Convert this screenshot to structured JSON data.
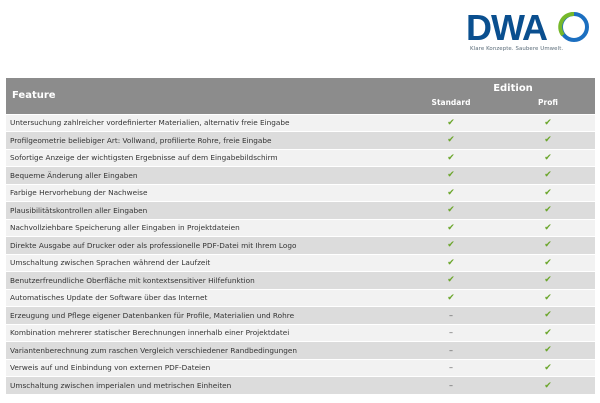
{
  "logo": {
    "wordmark": "DWA",
    "tagline": "Klare Konzepte. Saubere Umwelt.",
    "colors": {
      "text": "#0a4f8f",
      "ring_blue": "#1c6fc0",
      "ring_green": "#76b82a"
    }
  },
  "table": {
    "header": {
      "feature": "Feature",
      "edition": "Edition",
      "standard": "Standard",
      "profi": "Profi"
    },
    "rows": [
      {
        "feature": "Untersuchung zahlreicher vordefinierter Materialien, alternativ freie Eingabe",
        "standard": "✔",
        "profi": "✔"
      },
      {
        "feature": "Profilgeometrie beliebiger Art: Vollwand, profilierte Rohre, freie Eingabe",
        "standard": "✔",
        "profi": "✔"
      },
      {
        "feature": "Sofortige Anzeige der wichtigsten Ergebnisse auf dem Eingabebildschirm",
        "standard": "✔",
        "profi": "✔"
      },
      {
        "feature": "Bequeme Änderung aller Eingaben",
        "standard": "✔",
        "profi": "✔"
      },
      {
        "feature": "Farbige Hervorhebung der Nachweise",
        "standard": "✔",
        "profi": "✔"
      },
      {
        "feature": "Plausibilitätskontrollen aller Eingaben",
        "standard": "✔",
        "profi": "✔"
      },
      {
        "feature": "Nachvollziehbare Speicherung aller Eingaben in Projektdateien",
        "standard": "✔",
        "profi": "✔"
      },
      {
        "feature": "Direkte Ausgabe auf Drucker oder als professionelle PDF-Datei mit Ihrem Logo",
        "standard": "✔",
        "profi": "✔"
      },
      {
        "feature": "Umschaltung zwischen Sprachen während der Laufzeit",
        "standard": "✔",
        "profi": "✔"
      },
      {
        "feature": "Benutzerfreundliche Oberfläche mit kontextsensitiver Hilfefunktion",
        "standard": "✔",
        "profi": "✔"
      },
      {
        "feature": "Automatisches Update der Software über das Internet",
        "standard": "✔",
        "profi": "✔"
      },
      {
        "feature": "Erzeugung und Pflege eigener Datenbanken für Profile, Materialien und Rohre",
        "standard": "–",
        "profi": "✔"
      },
      {
        "feature": "Kombination mehrerer statischer Berechnungen innerhalb einer Projektdatei",
        "standard": "–",
        "profi": "✔"
      },
      {
        "feature": "Variantenberechnung zum raschen Vergleich verschiedener Randbedingungen",
        "standard": "–",
        "profi": "✔"
      },
      {
        "feature": "Verweis auf und Einbindung von externen PDF-Dateien",
        "standard": "–",
        "profi": "✔"
      },
      {
        "feature": "Umschaltung zwischen imperialen und metrischen Einheiten",
        "standard": "–",
        "profi": "✔"
      }
    ],
    "colors": {
      "header_bg": "#8c8c8c",
      "row_light": "#f2f2f2",
      "row_dark": "#dcdcdc",
      "check": "#6aa52a"
    }
  }
}
